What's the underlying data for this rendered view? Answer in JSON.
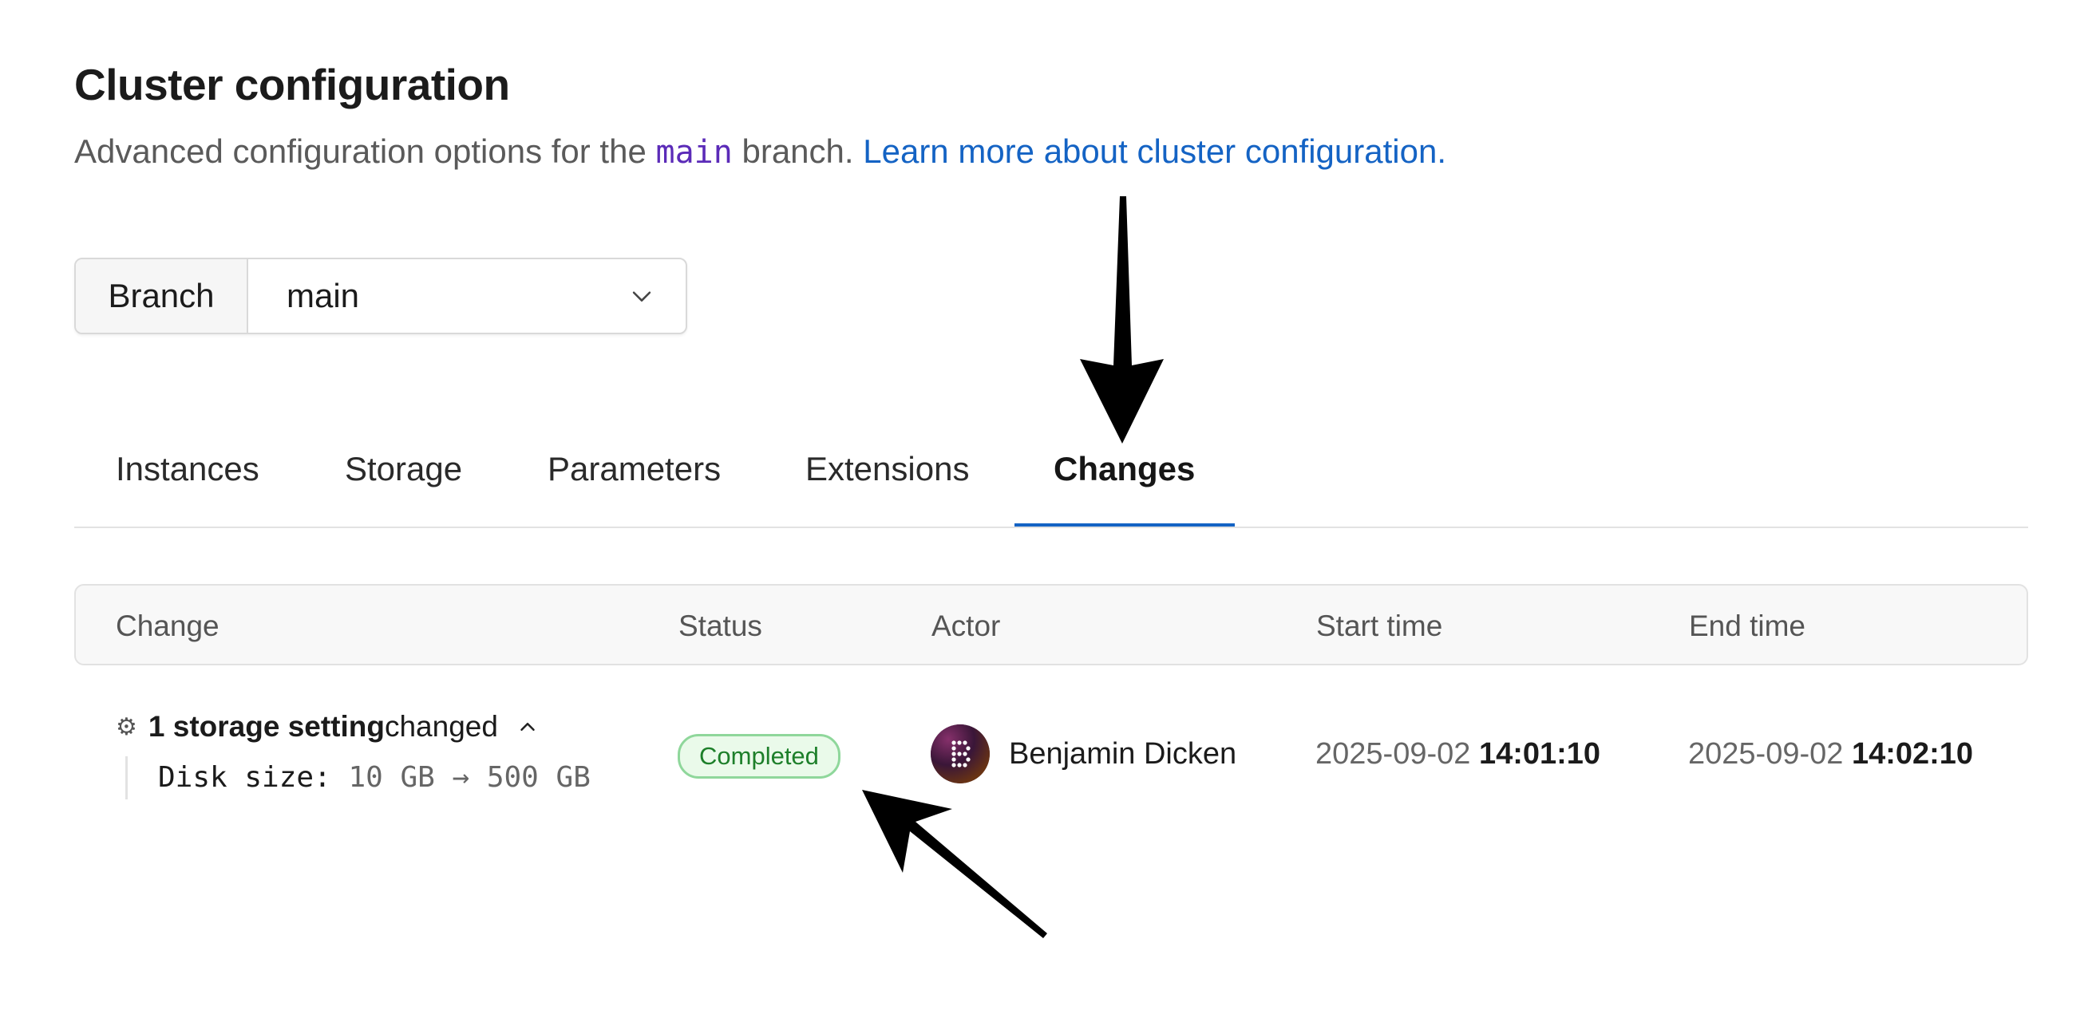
{
  "header": {
    "title": "Cluster configuration",
    "subtitle_prefix": "Advanced configuration options for the ",
    "subtitle_code": "main",
    "subtitle_suffix": " branch. ",
    "learn_more_link": "Learn more about cluster configuration.",
    "colors": {
      "link": "#1463c4",
      "code": "#5b2bb8"
    }
  },
  "branch_selector": {
    "label": "Branch",
    "value": "main",
    "icon": "chevron-down-icon"
  },
  "tabs": [
    {
      "label": "Instances",
      "active": false
    },
    {
      "label": "Storage",
      "active": false
    },
    {
      "label": "Parameters",
      "active": false
    },
    {
      "label": "Extensions",
      "active": false
    },
    {
      "label": "Changes",
      "active": true
    }
  ],
  "table": {
    "columns": [
      "Change",
      "Status",
      "Actor",
      "Start time",
      "End time"
    ],
    "rows": [
      {
        "change": {
          "gear_icon": "gear-icon",
          "summary_bold": "1 storage setting",
          "summary_rest": " changed",
          "collapse_icon": "chevron-up-icon",
          "detail_key": "Disk size:",
          "detail_value": "10 GB → 500 GB"
        },
        "status": "Completed",
        "actor": "Benjamin Dicken",
        "start_date": "2025-09-02",
        "start_time": "14:01:10",
        "end_date": "2025-09-02",
        "end_time": "14:02:10"
      }
    ]
  },
  "annotations": [
    "arrow-to-changes-tab",
    "arrow-to-completed-status"
  ]
}
